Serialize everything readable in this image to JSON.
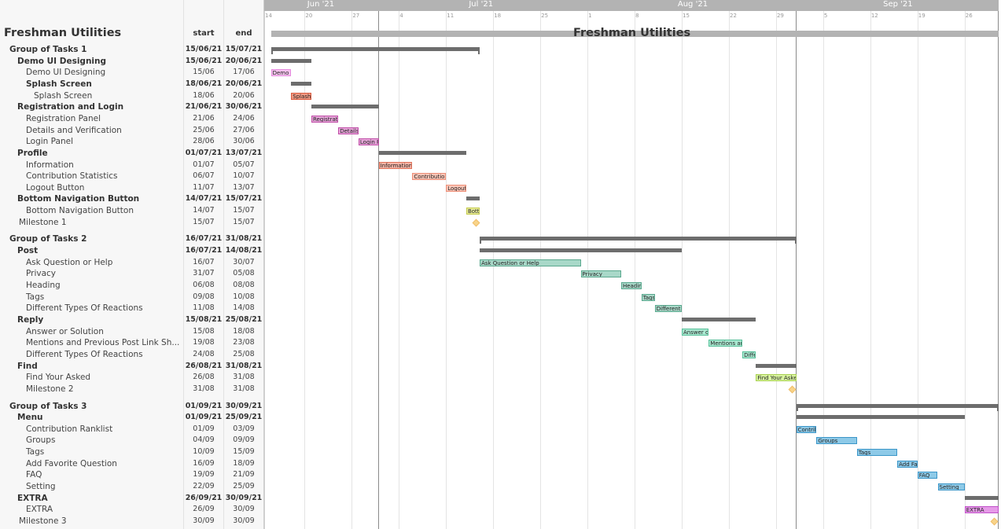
{
  "project": {
    "title": "Freshman Utilities",
    "columns": {
      "start": "start",
      "end": "end"
    }
  },
  "timeline": {
    "months": [
      {
        "label": "Jun '21"
      },
      {
        "label": "Jul '21"
      },
      {
        "label": "Aug '21"
      },
      {
        "label": "Sep '21"
      }
    ],
    "week_ticks": [
      "14",
      "20",
      "27",
      "4",
      "11",
      "18",
      "25",
      "1",
      "8",
      "15",
      "22",
      "29",
      "5",
      "12",
      "19",
      "26"
    ]
  },
  "colors": {
    "summary": "#6d6d6d",
    "project_bar": "#b3b3b3",
    "milestone": "#f8d48a",
    "pink": "#f7c4ef",
    "pink_border": "#e78be0",
    "salmon": "#f29a84",
    "salmon_border": "#d85c40",
    "magenta": "#e6a3d8",
    "magenta_border": "#c050a8",
    "rose": "#f6b4a6",
    "rose_border": "#e0745c",
    "lightrose": "#fbc6b8",
    "lightrose_border": "#ec8f78",
    "yellow": "#e8ec9a",
    "yellow_border": "#c4ca4c",
    "teal": "#a8d8c8",
    "teal_border": "#5aa88e",
    "mint": "#a8e8d0",
    "mint_border": "#58c09a",
    "lime": "#d8f4a0",
    "lime_border": "#a8d050",
    "blue": "#8ecae8",
    "blue_border": "#3c96c8",
    "violet": "#e69ae8",
    "violet_border": "#c050c8"
  },
  "chart_data": {
    "type": "gantt",
    "title": "Freshman Utilities",
    "x_range": [
      "2021-06-14",
      "2021-10-01"
    ],
    "rows": [
      {
        "name": "Group of Tasks 1",
        "level": 0,
        "kind": "summary",
        "start": "15/06/21",
        "end": "15/07/21",
        "s": "2021-06-15",
        "e": "2021-07-15"
      },
      {
        "name": "Demo UI Designing",
        "level": 1,
        "kind": "summary",
        "start": "15/06/21",
        "end": "20/06/21",
        "s": "2021-06-15",
        "e": "2021-06-20"
      },
      {
        "name": "Demo UI Designing",
        "level": 2,
        "kind": "task",
        "start": "15/06",
        "end": "17/06",
        "s": "2021-06-15",
        "e": "2021-06-17",
        "bar_label": "Demo",
        "color": "pink"
      },
      {
        "name": "Splash Screen",
        "level": 2,
        "kind": "summary",
        "start": "18/06/21",
        "end": "20/06/21",
        "s": "2021-06-18",
        "e": "2021-06-20"
      },
      {
        "name": "Splash Screen",
        "level": 3,
        "kind": "task",
        "start": "18/06",
        "end": "20/06",
        "s": "2021-06-18",
        "e": "2021-06-20",
        "bar_label": "Splash",
        "color": "salmon"
      },
      {
        "name": "Registration and Login",
        "level": 1,
        "kind": "summary",
        "start": "21/06/21",
        "end": "30/06/21",
        "s": "2021-06-21",
        "e": "2021-06-30"
      },
      {
        "name": "Registration Panel",
        "level": 2,
        "kind": "task",
        "start": "21/06",
        "end": "24/06",
        "s": "2021-06-21",
        "e": "2021-06-24",
        "bar_label": "Registrati",
        "color": "magenta"
      },
      {
        "name": "Details and Verification",
        "level": 2,
        "kind": "task",
        "start": "25/06",
        "end": "27/06",
        "s": "2021-06-25",
        "e": "2021-06-27",
        "bar_label": "Details",
        "color": "magenta"
      },
      {
        "name": "Login Panel",
        "level": 2,
        "kind": "task",
        "start": "28/06",
        "end": "30/06",
        "s": "2021-06-28",
        "e": "2021-06-30",
        "bar_label": "Login P",
        "color": "magenta"
      },
      {
        "name": "Profile",
        "level": 1,
        "kind": "summary",
        "start": "01/07/21",
        "end": "13/07/21",
        "s": "2021-07-01",
        "e": "2021-07-13"
      },
      {
        "name": " Information",
        "level": 2,
        "kind": "task",
        "start": "01/07",
        "end": "05/07",
        "s": "2021-07-01",
        "e": "2021-07-05",
        "bar_label": "Information",
        "color": "rose"
      },
      {
        "name": "Contribution Statistics",
        "level": 2,
        "kind": "task",
        "start": "06/07",
        "end": "10/07",
        "s": "2021-07-06",
        "e": "2021-07-10",
        "bar_label": "Contribution",
        "color": "lightrose"
      },
      {
        "name": "Logout Button",
        "level": 2,
        "kind": "task",
        "start": "11/07",
        "end": "13/07",
        "s": "2021-07-11",
        "e": "2021-07-13",
        "bar_label": "Logout",
        "color": "lightrose"
      },
      {
        "name": "Bottom Navigation Button",
        "level": 1,
        "kind": "summary",
        "start": "14/07/21",
        "end": "15/07/21",
        "s": "2021-07-14",
        "e": "2021-07-15"
      },
      {
        "name": "Bottom Navigation Button",
        "level": 2,
        "kind": "task",
        "start": "14/07",
        "end": "15/07",
        "s": "2021-07-14",
        "e": "2021-07-15",
        "bar_label": "Bott",
        "color": "yellow"
      },
      {
        "name": "Milestone 1",
        "level": 1,
        "kind": "milestone",
        "start": "15/07",
        "end": "15/07",
        "s": "2021-07-15",
        "e": "2021-07-15"
      },
      {
        "gap": true
      },
      {
        "name": "Group of Tasks 2",
        "level": 0,
        "kind": "summary",
        "start": "16/07/21",
        "end": "31/08/21",
        "s": "2021-07-16",
        "e": "2021-08-31"
      },
      {
        "name": "Post",
        "level": 1,
        "kind": "summary",
        "start": "16/07/21",
        "end": "14/08/21",
        "s": "2021-07-16",
        "e": "2021-08-14"
      },
      {
        "name": "Ask Question or Help",
        "level": 2,
        "kind": "task",
        "start": "16/07",
        "end": "30/07",
        "s": "2021-07-16",
        "e": "2021-07-30",
        "bar_label": "Ask Question or Help",
        "color": "teal"
      },
      {
        "name": "Privacy",
        "level": 2,
        "kind": "task",
        "start": "31/07",
        "end": "05/08",
        "s": "2021-07-31",
        "e": "2021-08-05",
        "bar_label": "Privacy",
        "color": "teal"
      },
      {
        "name": "Heading",
        "level": 2,
        "kind": "task",
        "start": "06/08",
        "end": "08/08",
        "s": "2021-08-06",
        "e": "2021-08-08",
        "bar_label": "Headin",
        "color": "teal"
      },
      {
        "name": "Tags",
        "level": 2,
        "kind": "task",
        "start": "09/08",
        "end": "10/08",
        "s": "2021-08-09",
        "e": "2021-08-10",
        "bar_label": "Tags",
        "color": "teal"
      },
      {
        "name": "Different Types Of Reactions",
        "level": 2,
        "kind": "task",
        "start": "11/08",
        "end": "14/08",
        "s": "2021-08-11",
        "e": "2021-08-14",
        "bar_label": "Different",
        "color": "teal"
      },
      {
        "name": "Reply",
        "level": 1,
        "kind": "summary",
        "start": "15/08/21",
        "end": "25/08/21",
        "s": "2021-08-15",
        "e": "2021-08-25"
      },
      {
        "name": "Answer or Solution",
        "level": 2,
        "kind": "task",
        "start": "15/08",
        "end": "18/08",
        "s": "2021-08-15",
        "e": "2021-08-18",
        "bar_label": "Answer or",
        "color": "mint"
      },
      {
        "name": "Mentions and  Previous Post Link Sh...",
        "level": 2,
        "kind": "task",
        "start": "19/08",
        "end": "23/08",
        "s": "2021-08-19",
        "e": "2021-08-23",
        "bar_label": "Mentions an",
        "color": "mint"
      },
      {
        "name": "Different Types Of Reactions",
        "level": 2,
        "kind": "task",
        "start": "24/08",
        "end": "25/08",
        "s": "2021-08-24",
        "e": "2021-08-25",
        "bar_label": "Diffe",
        "color": "mint"
      },
      {
        "name": "Find",
        "level": 1,
        "kind": "summary",
        "start": "26/08/21",
        "end": "31/08/21",
        "s": "2021-08-26",
        "e": "2021-08-31"
      },
      {
        "name": "Find Your Asked",
        "level": 2,
        "kind": "task",
        "start": "26/08",
        "end": "31/08",
        "s": "2021-08-26",
        "e": "2021-08-31",
        "bar_label": "Find Your Aske",
        "color": "lime"
      },
      {
        "name": "Milestone 2",
        "level": 2,
        "kind": "milestone",
        "start": "31/08",
        "end": "31/08",
        "s": "2021-08-31",
        "e": "2021-08-31"
      },
      {
        "gap": true
      },
      {
        "name": "Group of Tasks 3",
        "level": 0,
        "kind": "summary",
        "start": "01/09/21",
        "end": "30/09/21",
        "s": "2021-09-01",
        "e": "2021-09-30"
      },
      {
        "name": "Menu",
        "level": 1,
        "kind": "summary",
        "start": "01/09/21",
        "end": "25/09/21",
        "s": "2021-09-01",
        "e": "2021-09-25"
      },
      {
        "name": "Contribution Ranklist",
        "level": 2,
        "kind": "task",
        "start": "01/09",
        "end": "03/09",
        "s": "2021-09-01",
        "e": "2021-09-03",
        "bar_label": "Contrib",
        "color": "blue"
      },
      {
        "name": "Groups",
        "level": 2,
        "kind": "task",
        "start": "04/09",
        "end": "09/09",
        "s": "2021-09-04",
        "e": "2021-09-09",
        "bar_label": "Groups",
        "color": "blue"
      },
      {
        "name": "Tags",
        "level": 2,
        "kind": "task",
        "start": "10/09",
        "end": "15/09",
        "s": "2021-09-10",
        "e": "2021-09-15",
        "bar_label": "Tags",
        "color": "blue"
      },
      {
        "name": "Add Favorite Question",
        "level": 2,
        "kind": "task",
        "start": "16/09",
        "end": "18/09",
        "s": "2021-09-16",
        "e": "2021-09-18",
        "bar_label": "Add Fa",
        "color": "blue"
      },
      {
        "name": "FAQ",
        "level": 2,
        "kind": "task",
        "start": "19/09",
        "end": "21/09",
        "s": "2021-09-19",
        "e": "2021-09-21",
        "bar_label": "FAQ",
        "color": "blue"
      },
      {
        "name": "Setting",
        "level": 2,
        "kind": "task",
        "start": "22/09",
        "end": "25/09",
        "s": "2021-09-22",
        "e": "2021-09-25",
        "bar_label": "Setting",
        "color": "blue"
      },
      {
        "name": "EXTRA",
        "level": 1,
        "kind": "summary",
        "start": "26/09/21",
        "end": "30/09/21",
        "s": "2021-09-26",
        "e": "2021-09-30"
      },
      {
        "name": "EXTRA",
        "level": 2,
        "kind": "task",
        "start": "26/09",
        "end": "30/09",
        "s": "2021-09-26",
        "e": "2021-09-30",
        "bar_label": "EXTRA",
        "color": "violet"
      },
      {
        "name": "Milestone 3",
        "level": 1,
        "kind": "milestone",
        "start": "30/09",
        "end": "30/09",
        "s": "2021-09-30",
        "e": "2021-09-30"
      }
    ]
  }
}
